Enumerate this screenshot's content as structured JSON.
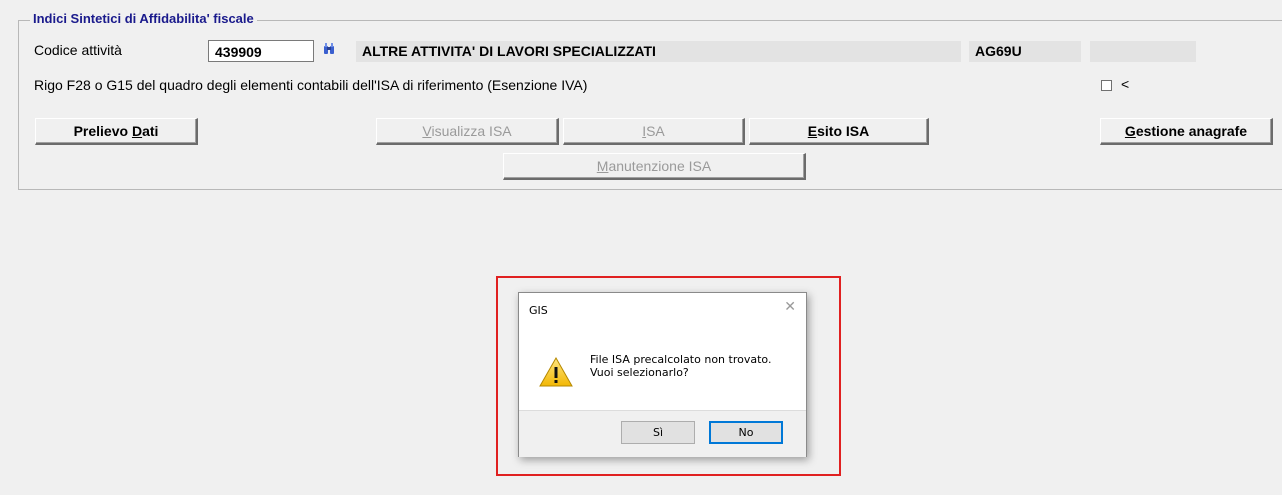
{
  "group": {
    "title": "Indici Sintetici di Affidabilita' fiscale"
  },
  "activity": {
    "label": "Codice attività",
    "code": "439909",
    "description": "ALTRE ATTIVITA' DI LAVORI SPECIALIZZATI",
    "isa_code": "AG69U",
    "extra_value": ""
  },
  "exemption": {
    "label": "Rigo F28 o G15 del quadro degli elementi contabili dell'ISA di riferimento (Esenzione IVA)",
    "checked": false,
    "checkbox_label": "<"
  },
  "buttons": {
    "prelievo": {
      "before": "Prelievo ",
      "accel": "D",
      "after": "ati"
    },
    "visualizza": {
      "before": "",
      "accel": "V",
      "after": "isualizza ISA"
    },
    "isa": {
      "before": "",
      "accel": "I",
      "after": "SA"
    },
    "esito": {
      "before": "",
      "accel": "E",
      "after": "sito ISA"
    },
    "gestione": {
      "before": "",
      "accel": "G",
      "after": "estione anagrafe"
    },
    "manutenzione": {
      "before": "",
      "accel": "M",
      "after": "anutenzione ISA"
    }
  },
  "dialog": {
    "title": "GIS",
    "close_glyph": "✕",
    "message_line1": "File ISA precalcolato non trovato.",
    "message_line2": "Vuoi selezionarlo?",
    "icon": "warning-icon",
    "yes_label": "Sì",
    "no_label": "No"
  },
  "colors": {
    "group_title": "#1a1a8c",
    "highlight_border": "#e02020",
    "window_bg": "#f0f0f0"
  }
}
